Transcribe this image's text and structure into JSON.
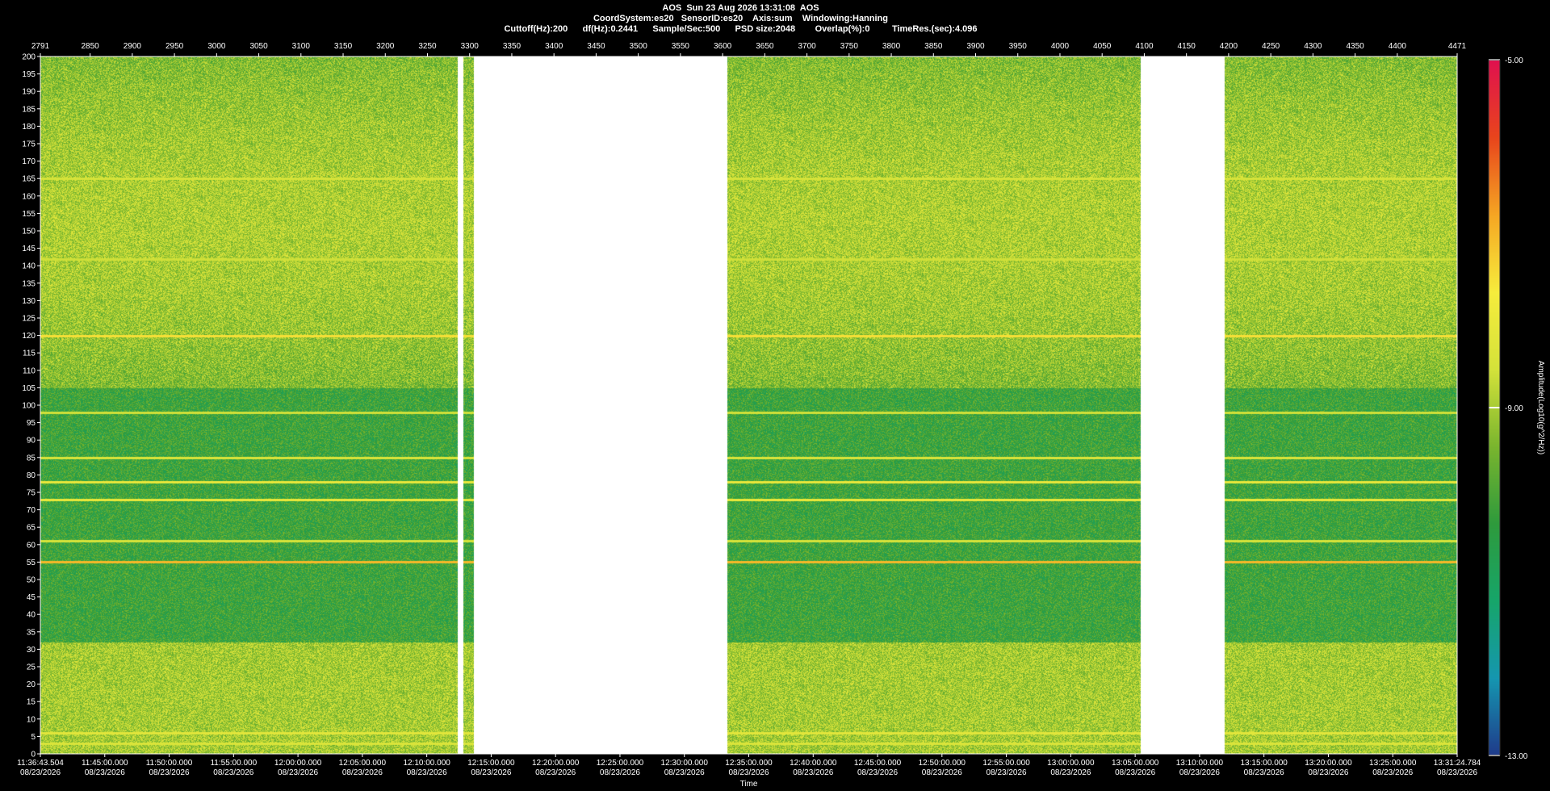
{
  "header": {
    "line1": "AOS  Sun 23 Aug 2026 13:31:08  AOS",
    "line2": "CoordSystem:es20   SensorID:es20    Axis:sum    Windowing:Hanning",
    "line3": "Cuttoff(Hz):200      df(Hz):0.2441      Sample/Sec:500      PSD size:2048        Overlap(%):0         TimeRes.(sec):4.096"
  },
  "colors": {
    "background": "#000000",
    "text": "#ffffff",
    "gap": "#ffffff",
    "colormap": [
      "#1f3a8a",
      "#1596b0",
      "#16a56a",
      "#2e9a3c",
      "#7ab52e",
      "#d4e23a",
      "#f6ec3c",
      "#f5a623",
      "#e8451c",
      "#e0114f"
    ]
  },
  "chart_data": {
    "type": "heatmap",
    "title": "AOS  Sun 23 Aug 2026 13:31:08  AOS",
    "xlabel": "Time",
    "colorbar_label": "Amplitude(Log10(g^2/Hz))",
    "colorbar_range": [
      -13.0,
      -5.0
    ],
    "colorbar_ticks": [
      "-5.00",
      "-9.00",
      "-13.00"
    ],
    "ylim": [
      0,
      200
    ],
    "ytick_step": 5,
    "top_axis": {
      "range": [
        2791,
        4471
      ],
      "ticks": [
        "2791",
        "2850",
        "2900",
        "2950",
        "3000",
        "3050",
        "3100",
        "3150",
        "3200",
        "3250",
        "3300",
        "3350",
        "3400",
        "3450",
        "3500",
        "3550",
        "3600",
        "3650",
        "3700",
        "3750",
        "3800",
        "3850",
        "3900",
        "3950",
        "4000",
        "4050",
        "4100",
        "4150",
        "4200",
        "4250",
        "4300",
        "4350",
        "4400",
        "4471"
      ]
    },
    "bottom_axis": {
      "ticks": [
        {
          "time": "11:36:43.504",
          "date": "08/23/2026"
        },
        {
          "time": "11:45:00.000",
          "date": "08/23/2026"
        },
        {
          "time": "11:50:00.000",
          "date": "08/23/2026"
        },
        {
          "time": "11:55:00.000",
          "date": "08/23/2026"
        },
        {
          "time": "12:00:00.000",
          "date": "08/23/2026"
        },
        {
          "time": "12:05:00.000",
          "date": "08/23/2026"
        },
        {
          "time": "12:10:00.000",
          "date": "08/23/2026"
        },
        {
          "time": "12:15:00.000",
          "date": "08/23/2026"
        },
        {
          "time": "12:20:00.000",
          "date": "08/23/2026"
        },
        {
          "time": "12:25:00.000",
          "date": "08/23/2026"
        },
        {
          "time": "12:30:00.000",
          "date": "08/23/2026"
        },
        {
          "time": "12:35:00.000",
          "date": "08/23/2026"
        },
        {
          "time": "12:40:00.000",
          "date": "08/23/2026"
        },
        {
          "time": "12:45:00.000",
          "date": "08/23/2026"
        },
        {
          "time": "12:50:00.000",
          "date": "08/23/2026"
        },
        {
          "time": "12:55:00.000",
          "date": "08/23/2026"
        },
        {
          "time": "13:00:00.000",
          "date": "08/23/2026"
        },
        {
          "time": "13:05:00.000",
          "date": "08/23/2026"
        },
        {
          "time": "13:10:00.000",
          "date": "08/23/2026"
        },
        {
          "time": "13:15:00.000",
          "date": "08/23/2026"
        },
        {
          "time": "13:20:00.000",
          "date": "08/23/2026"
        },
        {
          "time": "13:25:00.000",
          "date": "08/23/2026"
        },
        {
          "time": "13:31:24.784",
          "date": "08/23/2026"
        }
      ]
    },
    "data_gaps_frame": [
      [
        3285,
        3292
      ],
      [
        3305,
        3605
      ],
      [
        4095,
        4195
      ]
    ],
    "persistent_lines_hz": [
      {
        "hz": 165,
        "level": -8.5
      },
      {
        "hz": 142,
        "level": -8.6
      },
      {
        "hz": 120,
        "level": -7.5
      },
      {
        "hz": 98,
        "level": -8.6
      },
      {
        "hz": 85,
        "level": -8.4
      },
      {
        "hz": 78,
        "level": -8.0
      },
      {
        "hz": 73,
        "level": -8.0
      },
      {
        "hz": 61,
        "level": -8.5
      },
      {
        "hz": 55,
        "level": -7.0
      },
      {
        "hz": 6,
        "level": -8.2
      },
      {
        "hz": 3,
        "level": -8.4
      }
    ],
    "bands": [
      {
        "from_hz": 105,
        "to_hz": 200,
        "level": -9.4
      },
      {
        "from_hz": 32,
        "to_hz": 105,
        "level": -10.2
      },
      {
        "from_hz": 0,
        "to_hz": 32,
        "level": -9.0
      }
    ]
  }
}
